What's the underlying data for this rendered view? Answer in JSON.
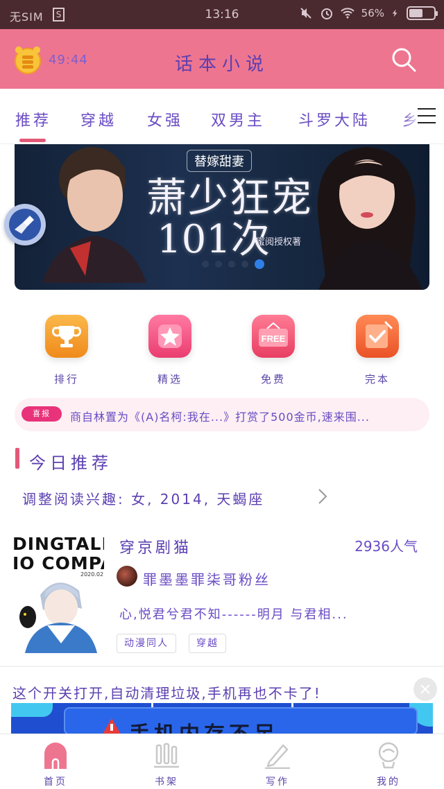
{
  "status_bar": {
    "carrier": "无SIM",
    "time": "13:16",
    "battery": "56%",
    "battery_level": 0.56
  },
  "header": {
    "timer": "49:44",
    "title": "话本小说"
  },
  "tabs": [
    "推荐",
    "穿越",
    "女强",
    "双男主",
    "斗罗大陆",
    "乡"
  ],
  "active_tab": "推荐",
  "banner": {
    "subtitle": "替嫁甜妻",
    "title_line1": "萧少狂宠",
    "title_line2": "101次",
    "author": "蜜阅授权著",
    "slide_count": 5,
    "active_slide": 5
  },
  "categories": [
    {
      "label": "排行",
      "icon": "trophy-icon",
      "color": "#f5a02a"
    },
    {
      "label": "精选",
      "icon": "star-icon",
      "color": "#f04a7c"
    },
    {
      "label": "免费",
      "icon": "free-icon",
      "color": "#ef4a72"
    },
    {
      "label": "完本",
      "icon": "checkmark-icon",
      "color": "#f26a3a"
    }
  ],
  "notice": {
    "badge": "喜报",
    "text": "商自林置为《(A)名柯:我在...》打赏了500金币,速来围..."
  },
  "section": {
    "title": "今日推荐",
    "preferences": "调整阅读兴趣:  女,  2014,  天蝎座"
  },
  "book": {
    "cover_text_line1": "DINGTALK",
    "cover_text_line2": "IO COMPANY",
    "cover_date": "2020.02.",
    "title": "穿京剧猫",
    "popularity": "2936人气",
    "author": "罪墨墨罪柒哥粉丝",
    "description": "心,悦君兮君不知------明月  与君相...",
    "tags": [
      "动漫同人",
      "穿越"
    ]
  },
  "ad": {
    "text": "这个开关打开,自动清理垃圾,手机再也不卡了!",
    "image_text": "手机内存不足"
  },
  "bottom_nav": [
    {
      "label": "首页",
      "icon": "home-icon"
    },
    {
      "label": "书架",
      "icon": "bookshelf-icon"
    },
    {
      "label": "写作",
      "icon": "pen-icon"
    },
    {
      "label": "我的",
      "icon": "profile-icon"
    }
  ],
  "colors": {
    "accent": "#ee7590",
    "text": "#5b3fb0",
    "indicator": "#e35878"
  }
}
